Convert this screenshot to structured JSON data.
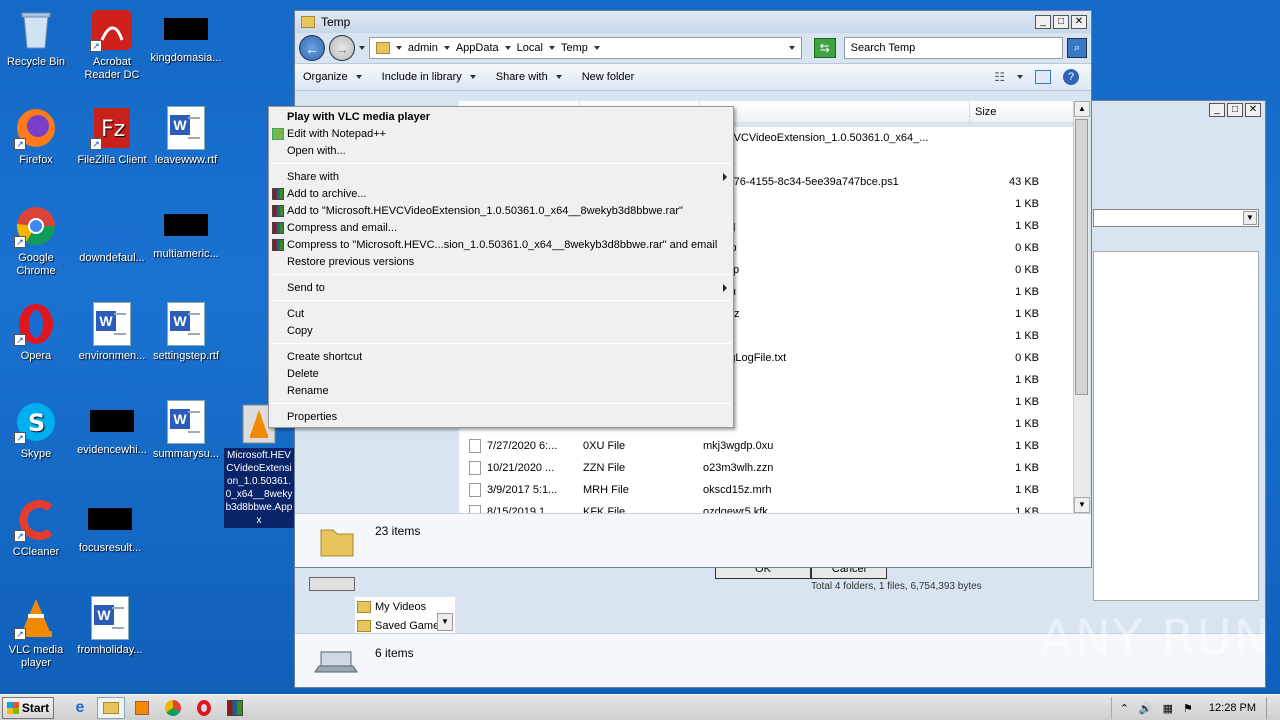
{
  "desktop": {
    "icons": [
      {
        "label": "Recycle Bin"
      },
      {
        "label": "Acrobat Reader DC"
      },
      {
        "label": "kingdomasia..."
      },
      {
        "label": "Firefox"
      },
      {
        "label": "FileZilla Client"
      },
      {
        "label": "leavewww.rtf"
      },
      {
        "label": "Google Chrome"
      },
      {
        "label": "downdefaul..."
      },
      {
        "label": "multiameric..."
      },
      {
        "label": "Opera"
      },
      {
        "label": "environmen..."
      },
      {
        "label": "settingstep.rtf"
      },
      {
        "label": "Skype"
      },
      {
        "label": "evidencewhi..."
      },
      {
        "label": "summarysu..."
      },
      {
        "label": "Microsoft.HEVCVideoExtension_1.0.50361.0_x64__8wekyb3d8bbwe.Appx"
      },
      {
        "label": "CCleaner"
      },
      {
        "label": "focusresult..."
      },
      {
        "label": "VLC media player"
      },
      {
        "label": "fromholiday..."
      }
    ]
  },
  "explorer_main": {
    "title": "Temp",
    "breadcrumb": [
      "admin",
      "AppData",
      "Local",
      "Temp"
    ],
    "search_placeholder": "Search Temp",
    "toolbar": {
      "organize": "Organize",
      "include_in_library": "Include in library",
      "share_with": "Share with",
      "new_folder": "New folder"
    },
    "col_size": "Size",
    "files": [
      {
        "date": "",
        "type": "",
        "name": "oft.HEVCVideoExtension_1.0.50361.0_x64_...",
        "size": ""
      },
      {
        "date": "",
        "type": "",
        "name": "SE",
        "size": ""
      },
      {
        "date": "",
        "type": "",
        "name": "tec-0376-4155-8c34-5ee39a747bce.ps1",
        "size": "43 KB"
      },
      {
        "date": "",
        "type": "",
        "name": "fp.0v0",
        "size": "1 KB"
      },
      {
        "date": "",
        "type": "",
        "name": "zpa.tlq",
        "size": "1 KB"
      },
      {
        "date": "",
        "type": "",
        "name": "92.tmp",
        "size": "0 KB"
      },
      {
        "date": "",
        "type": "",
        "name": "SA.tmp",
        "size": "0 KB"
      },
      {
        "date": "",
        "type": "",
        "name": "da.yau",
        "size": "1 KB"
      },
      {
        "date": "",
        "type": "",
        "name": "lyy.amz",
        "size": "1 KB"
      },
      {
        "date": "",
        "type": "",
        "name": "xu.ted",
        "size": "1 KB"
      },
      {
        "date": "",
        "type": "",
        "name": "DebugLogFile.txt",
        "size": "0 KB"
      },
      {
        "date": "",
        "type": "",
        "name": "oft.ttf",
        "size": "1 KB"
      },
      {
        "date": "",
        "type": "",
        "name": "ji.ehq",
        "size": "1 KB"
      },
      {
        "date": "",
        "type": "",
        "name": "tz.hvr",
        "size": "1 KB"
      },
      {
        "date": "7/27/2020 6:...",
        "type": "0XU File",
        "name": "mkj3wgdp.0xu",
        "size": "1 KB"
      },
      {
        "date": "10/21/2020 ...",
        "type": "ZZN File",
        "name": "o23m3wlh.zzn",
        "size": "1 KB"
      },
      {
        "date": "3/9/2017 5:1...",
        "type": "MRH File",
        "name": "okscd15z.mrh",
        "size": "1 KB"
      },
      {
        "date": "8/15/2019 1...",
        "type": "KFK File",
        "name": "ozdqewr5.kfk",
        "size": "1 KB"
      }
    ],
    "item_count": "23 items"
  },
  "explorer_back": {
    "sidebar": [
      "My Videos",
      "Saved Game"
    ],
    "status": "Total 4 folders, 1 files, 6,754,393 bytes",
    "buttons": [
      "OK",
      "Cancel"
    ],
    "item_count": "6 items"
  },
  "context_menu": {
    "play_vlc": "Play with VLC media player",
    "edit_npp": "Edit with Notepad++",
    "open_with": "Open with...",
    "share_with": "Share with",
    "add_archive": "Add to archive...",
    "add_rar": "Add to \"Microsoft.HEVCVideoExtension_1.0.50361.0_x64__8wekyb3d8bbwe.rar\"",
    "compress_email": "Compress and email...",
    "compress_rar_email": "Compress to \"Microsoft.HEVC...sion_1.0.50361.0_x64__8wekyb3d8bbwe.rar\" and email",
    "restore": "Restore previous versions",
    "send_to": "Send to",
    "cut": "Cut",
    "copy": "Copy",
    "create_shortcut": "Create shortcut",
    "delete": "Delete",
    "rename": "Rename",
    "properties": "Properties"
  },
  "taskbar": {
    "start": "Start",
    "clock": "12:28 PM"
  },
  "watermark": "ANY RUN"
}
